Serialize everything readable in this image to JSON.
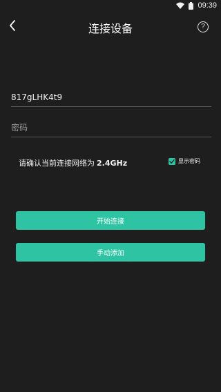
{
  "status": {
    "time": "09:39"
  },
  "header": {
    "title": "连接设备"
  },
  "form": {
    "ssid_value": "817gLHK4t9",
    "password_placeholder": "密码"
  },
  "hint": {
    "text": "请确认当前连接网络为",
    "frequency": "2.4GHz"
  },
  "show_password": {
    "label": "显示密码",
    "checked": true
  },
  "buttons": {
    "connect": "开始连接",
    "manual": "手动添加"
  },
  "colors": {
    "background": "#1e1e1e",
    "accent": "#2ec4a3",
    "divider": "#5a5a5a"
  },
  "icons": {
    "back": "chevron-left-icon",
    "help": "help-icon",
    "wifi": "wifi-icon",
    "battery": "battery-icon"
  }
}
